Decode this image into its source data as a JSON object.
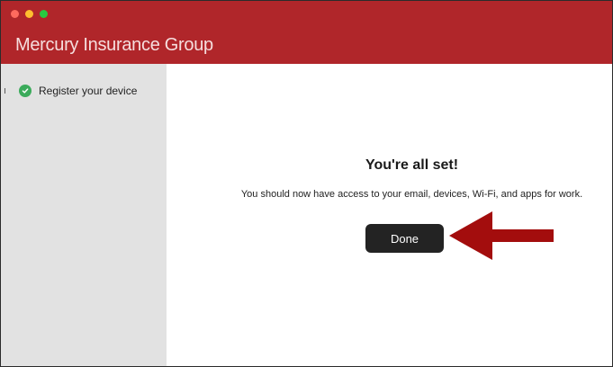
{
  "window": {
    "title": "Mercury Insurance Group",
    "controls": [
      "close",
      "minimize",
      "maximize"
    ]
  },
  "sidebar": {
    "items": [
      {
        "label": "Register your device",
        "status_icon": "check-circle-icon",
        "status": "complete"
      }
    ]
  },
  "main": {
    "heading": "You're all set!",
    "message": "You should now have access to your email, devices, Wi-Fi, and apps for work.",
    "done_label": "Done"
  },
  "annotation": {
    "icon": "arrow-left-icon",
    "color": "#a30d0d"
  },
  "colors": {
    "titlebar": "#b0262a",
    "sidebar": "#e2e2e2",
    "success": "#3bab5b",
    "button": "#232323"
  }
}
